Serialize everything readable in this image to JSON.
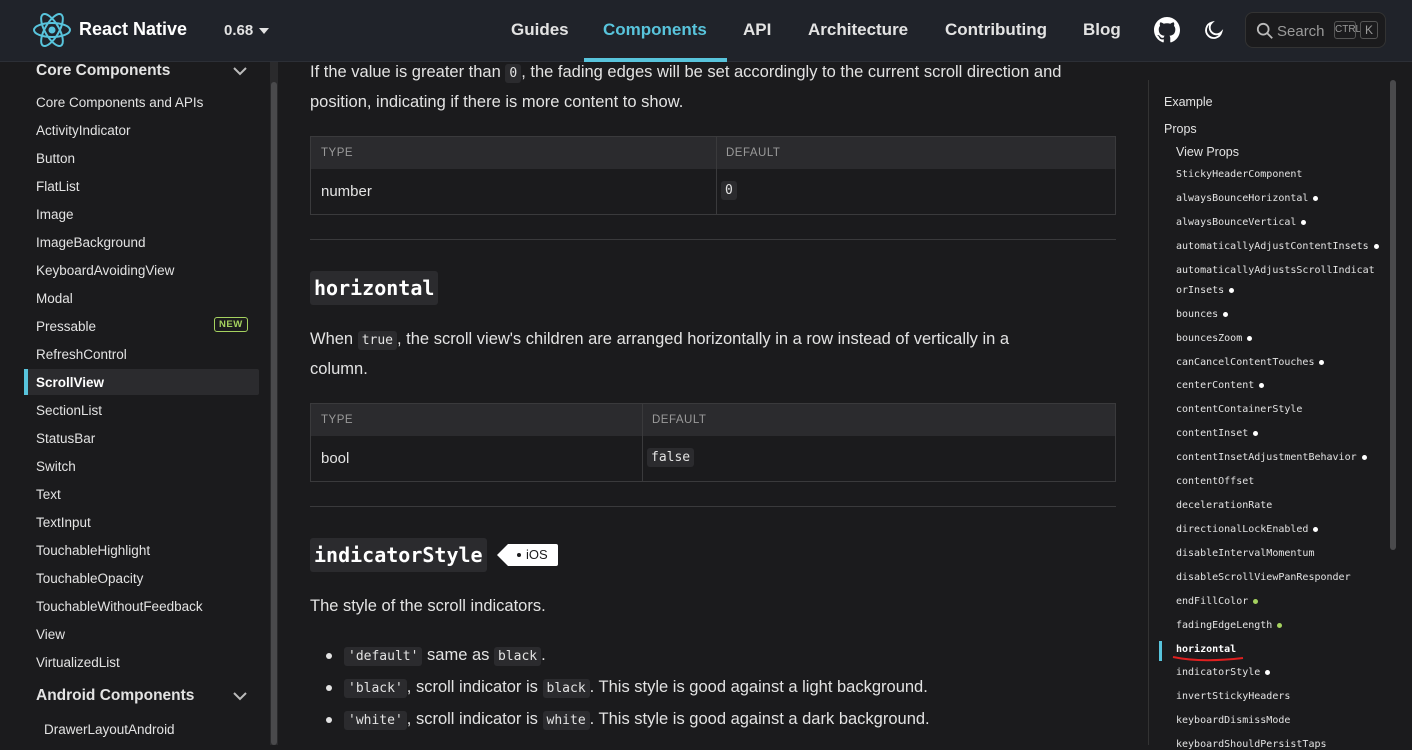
{
  "brand": {
    "name": "React Native",
    "version": "0.68"
  },
  "nav": {
    "links": [
      "Guides",
      "Components",
      "API",
      "Architecture",
      "Contributing",
      "Blog"
    ],
    "active": "Components",
    "search_label": "Search",
    "kbd_ctrl": "CTRL",
    "kbd_k": "K"
  },
  "sidebar": {
    "group1": "Core Components",
    "items": [
      "Core Components and APIs",
      "ActivityIndicator",
      "Button",
      "FlatList",
      "Image",
      "ImageBackground",
      "KeyboardAvoidingView",
      "Modal",
      "Pressable",
      "RefreshControl",
      "ScrollView",
      "SectionList",
      "StatusBar",
      "Switch",
      "Text",
      "TextInput",
      "TouchableHighlight",
      "TouchableOpacity",
      "TouchableWithoutFeedback",
      "View",
      "VirtualizedList"
    ],
    "active": "ScrollView",
    "badge": "NEW",
    "group2": "Android Components",
    "group2_items": [
      "DrawerLayoutAndroid"
    ]
  },
  "content": {
    "intro_line1_a": "If the value is greater than ",
    "intro_code": "0",
    "intro_line1_b": ", the fading edges will be set accordingly to the current scroll direction and",
    "intro_line2": "position, indicating if there is more content to show.",
    "table1": {
      "type_header": "TYPE",
      "default_header": "DEFAULT",
      "type": "number",
      "default": "0"
    },
    "horizontal_title": "horizontal",
    "horizontal_a": "When ",
    "horizontal_code": "true",
    "horizontal_b": ", the scroll view's children are arranged horizontally in a row instead of vertically in a",
    "horizontal_c": "column.",
    "table2": {
      "type_header": "TYPE",
      "default_header": "DEFAULT",
      "type": "bool",
      "default": "false"
    },
    "indicator_title": "indicatorStyle",
    "ios_tag": "iOS",
    "indicator_desc": "The style of the scroll indicators.",
    "bullets": [
      {
        "code": "'default'",
        "text": " same as ",
        "code2": "black",
        "tail": "."
      },
      {
        "code": "'black'",
        "text": ", scroll indicator is ",
        "code2": "black",
        "tail": ". This style is good against a light background."
      },
      {
        "code": "'white'",
        "text": ", scroll indicator is ",
        "code2": "white",
        "tail": ". This style is good against a dark background."
      }
    ]
  },
  "toc": {
    "example": "Example",
    "props": "Props",
    "view_props": "View Props",
    "items": [
      {
        "label": "StickyHeaderComponent",
        "dot": ""
      },
      {
        "label": "alwaysBounceHorizontal",
        "dot": "white"
      },
      {
        "label": "alwaysBounceVertical",
        "dot": "white"
      },
      {
        "label": "automaticallyAdjustContentInsets",
        "dot": "white"
      },
      {
        "label": "automaticallyAdjustsScrollIndicat",
        "dot": ""
      },
      {
        "label": "orInsets",
        "dot": "white"
      },
      {
        "label": "bounces",
        "dot": "white"
      },
      {
        "label": "bouncesZoom",
        "dot": "white"
      },
      {
        "label": "canCancelContentTouches",
        "dot": "white"
      },
      {
        "label": "centerContent",
        "dot": "white"
      },
      {
        "label": "contentContainerStyle",
        "dot": ""
      },
      {
        "label": "contentInset",
        "dot": "white"
      },
      {
        "label": "contentInsetAdjustmentBehavior",
        "dot": "white"
      },
      {
        "label": "contentOffset",
        "dot": ""
      },
      {
        "label": "decelerationRate",
        "dot": ""
      },
      {
        "label": "directionalLockEnabled",
        "dot": "white"
      },
      {
        "label": "disableIntervalMomentum",
        "dot": ""
      },
      {
        "label": "disableScrollViewPanResponder",
        "dot": ""
      },
      {
        "label": "endFillColor",
        "dot": "green"
      },
      {
        "label": "fadingEdgeLength",
        "dot": "green"
      },
      {
        "label": "horizontal",
        "dot": ""
      },
      {
        "label": "indicatorStyle",
        "dot": "white"
      },
      {
        "label": "invertStickyHeaders",
        "dot": ""
      },
      {
        "label": "keyboardDismissMode",
        "dot": ""
      },
      {
        "label": "keyboardShouldPersistTaps",
        "dot": ""
      }
    ],
    "active": "horizontal"
  },
  "colors": {
    "accent": "#58c4dc",
    "ios_dot": "#ffffff",
    "android_dot": "#a5d25f",
    "annotation": "#e02020"
  }
}
